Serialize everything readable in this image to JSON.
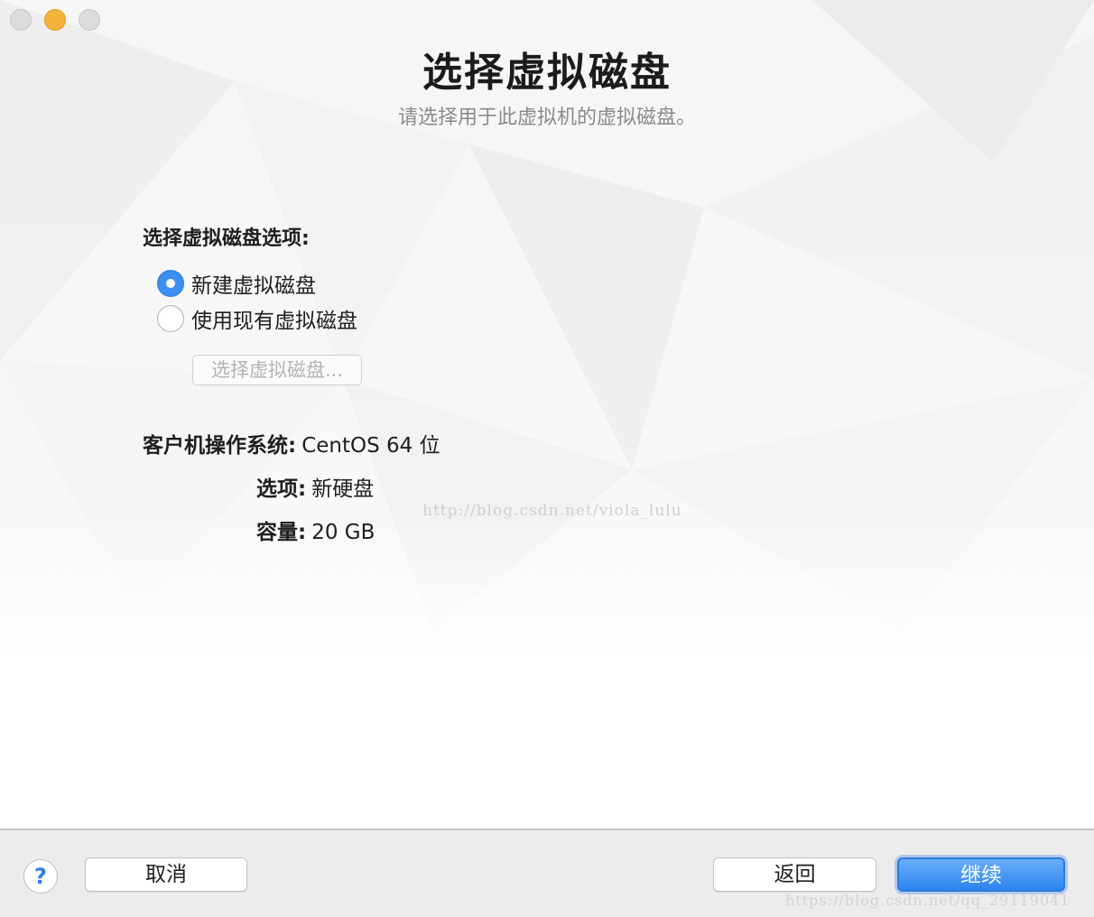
{
  "window": {
    "title": "选择虚拟磁盘",
    "subtitle": "请选择用于此虚拟机的虚拟磁盘。"
  },
  "disk_options": {
    "label": "选择虚拟磁盘选项:",
    "options": [
      {
        "label": "新建虚拟磁盘",
        "selected": true
      },
      {
        "label": "使用现有虚拟磁盘",
        "selected": false
      }
    ],
    "choose_button": "选择虚拟磁盘..."
  },
  "summary": {
    "os_label": "客户机操作系统:",
    "os_value": "CentOS 64 位",
    "option_label": "选项:",
    "option_value": "新硬盘",
    "capacity_label": "容量:",
    "capacity_value": "20 GB"
  },
  "watermark": "http://blog.csdn.net/viola_lulu",
  "footer": {
    "help": "?",
    "cancel": "取消",
    "back": "返回",
    "continue": "继续",
    "watermark": "https://blog.csdn.net/qq_29119041"
  },
  "colors": {
    "accent": "#2e83f0",
    "minimize_light": "#f5b23a",
    "inactive_light": "#dcdcdc"
  }
}
